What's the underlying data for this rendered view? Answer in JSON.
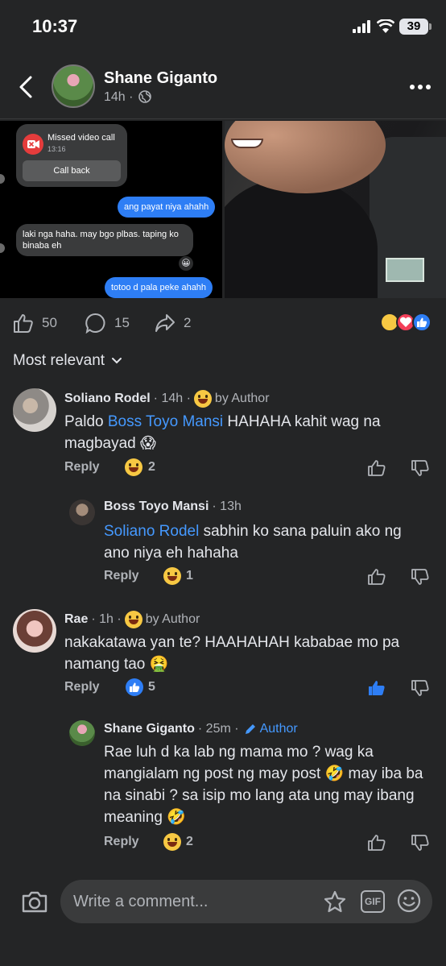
{
  "status": {
    "time": "10:37",
    "battery": "39"
  },
  "header": {
    "name": "Shane Giganto",
    "meta": "14h ·"
  },
  "screenshot": {
    "missed_title": "Missed video call",
    "missed_time": "13:16",
    "call_back": "Call back",
    "messages": [
      {
        "text": "ang payat niya ahahh",
        "dir": "out"
      },
      {
        "text": "laki nga haha. may bgo plbas. taping ko binaba eh",
        "dir": "in"
      },
      {
        "text": "totoo d pala peke ahahh",
        "dir": "out"
      }
    ]
  },
  "actions": {
    "likes": "50",
    "comments": "15",
    "shares": "2"
  },
  "sort_label": "Most relevant",
  "comments": [
    {
      "name": "Soliano Rodel",
      "time": "· 14h ·",
      "badge": "by Author",
      "mention": "Boss Toyo Mansi",
      "text_before": "Paldo ",
      "text_after": " HAHAHA kahit wag na magbayad 😱",
      "reply": "Reply",
      "reactions": "2"
    },
    {
      "name": "Boss Toyo Mansi",
      "time": "· 13h",
      "mention": "Soliano Rodel",
      "text_after": " sabhin ko sana paluin ako ng ano niya eh hahaha",
      "reply": "Reply",
      "reactions": "1"
    },
    {
      "name": "Rae",
      "time": "· 1h ·",
      "badge": "by Author",
      "text": "nakakatawa yan te? HAAHAHAH kababae mo pa namang tao 🤮",
      "reply": "Reply",
      "reactions": "5"
    },
    {
      "name": "Shane Giganto",
      "time": "· 25m ·",
      "badge": "Author",
      "text": "Rae luh d ka lab ng mama mo ? wag ka mangialam ng post ng may post 🤣 may iba ba na sinabi ? sa isip mo lang ata ung may ibang meaning 🤣",
      "reply": "Reply",
      "reactions": "2"
    }
  ],
  "composer": {
    "placeholder": "Write a comment...",
    "gif": "GIF"
  },
  "colors": {
    "bg": "#242526",
    "accent": "#4599ff",
    "like_blue": "#2e7ef5"
  }
}
